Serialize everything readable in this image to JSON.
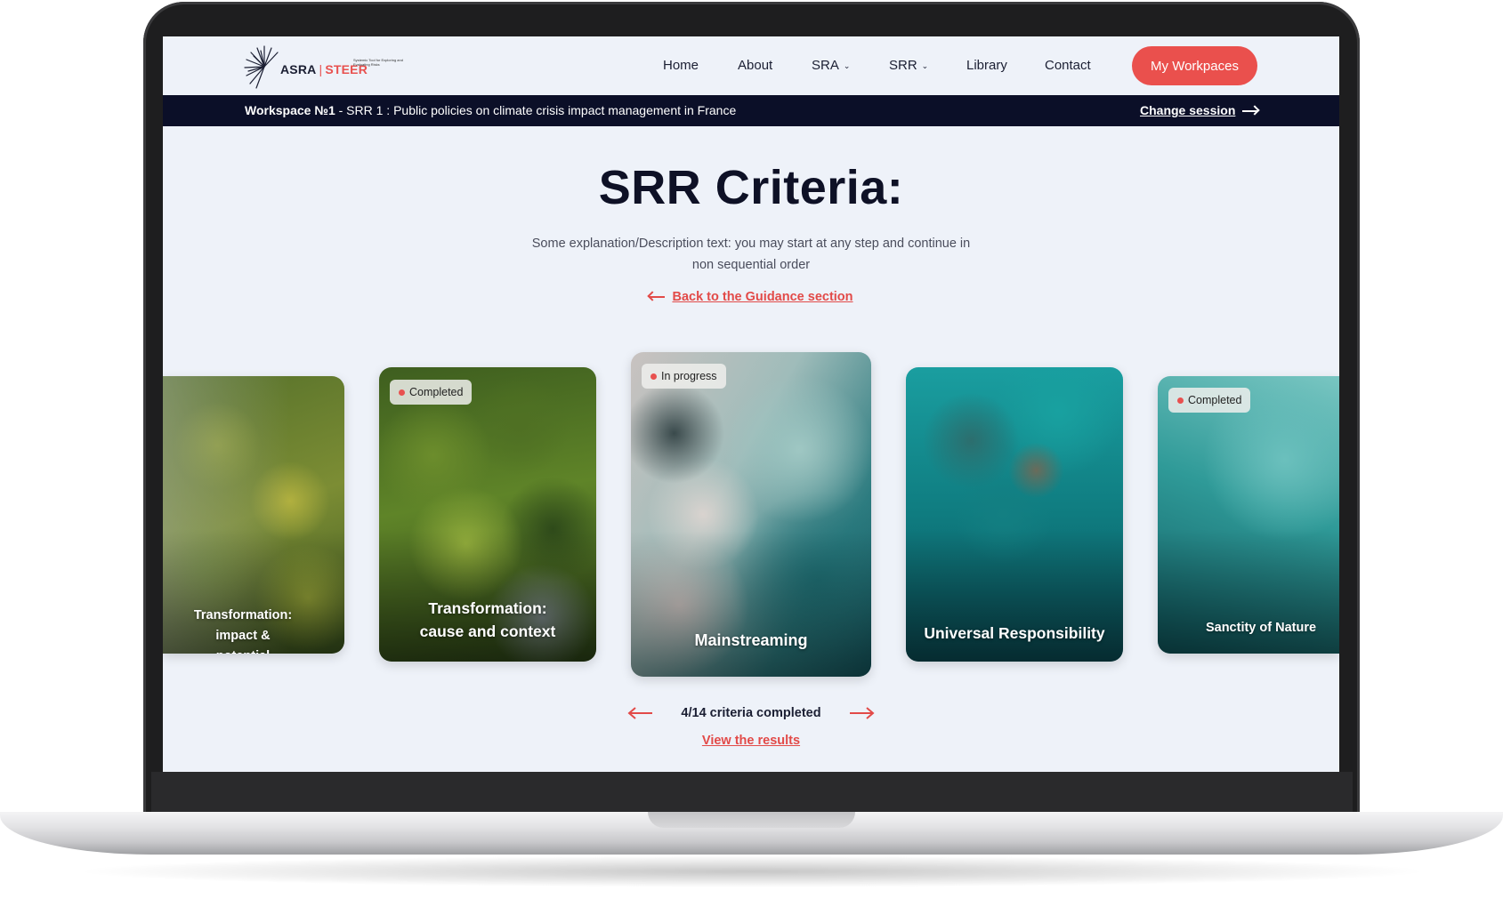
{
  "brand": {
    "name_left": "ASRA",
    "name_right": "STEER",
    "tagline": "Systemic Tool for Exploring and Evaluating Risks",
    "accent_color": "#ea504d",
    "dark_color": "#0b0f28"
  },
  "nav": {
    "items": [
      {
        "label": "Home"
      },
      {
        "label": "About"
      },
      {
        "label": "SRA",
        "has_dropdown": true
      },
      {
        "label": "SRR",
        "has_dropdown": true
      },
      {
        "label": "Library"
      },
      {
        "label": "Contact"
      }
    ],
    "cta_label": "My Workpaces"
  },
  "session": {
    "workspace": "Workspace №1",
    "details": " - SRR 1 : Public policies on climate crisis impact management in France",
    "change_label": "Change session"
  },
  "main": {
    "title": "SRR Criteria:",
    "description": "Some explanation/Description text: you may start at any step and continue in non sequential order",
    "back_label": "Back to the Guidance section"
  },
  "cards": [
    {
      "title": "Transformation: impact & potential",
      "status": ""
    },
    {
      "title": "Transformation: cause and context",
      "status": "Completed"
    },
    {
      "title": "Mainstreaming",
      "status": "In progress"
    },
    {
      "title": "Universal Responsibility",
      "status": ""
    },
    {
      "title": "Sanctity of Nature",
      "status": "Completed"
    }
  ],
  "pager": {
    "progress_text": "4/14 criteria completed",
    "results_label": "View the results"
  }
}
